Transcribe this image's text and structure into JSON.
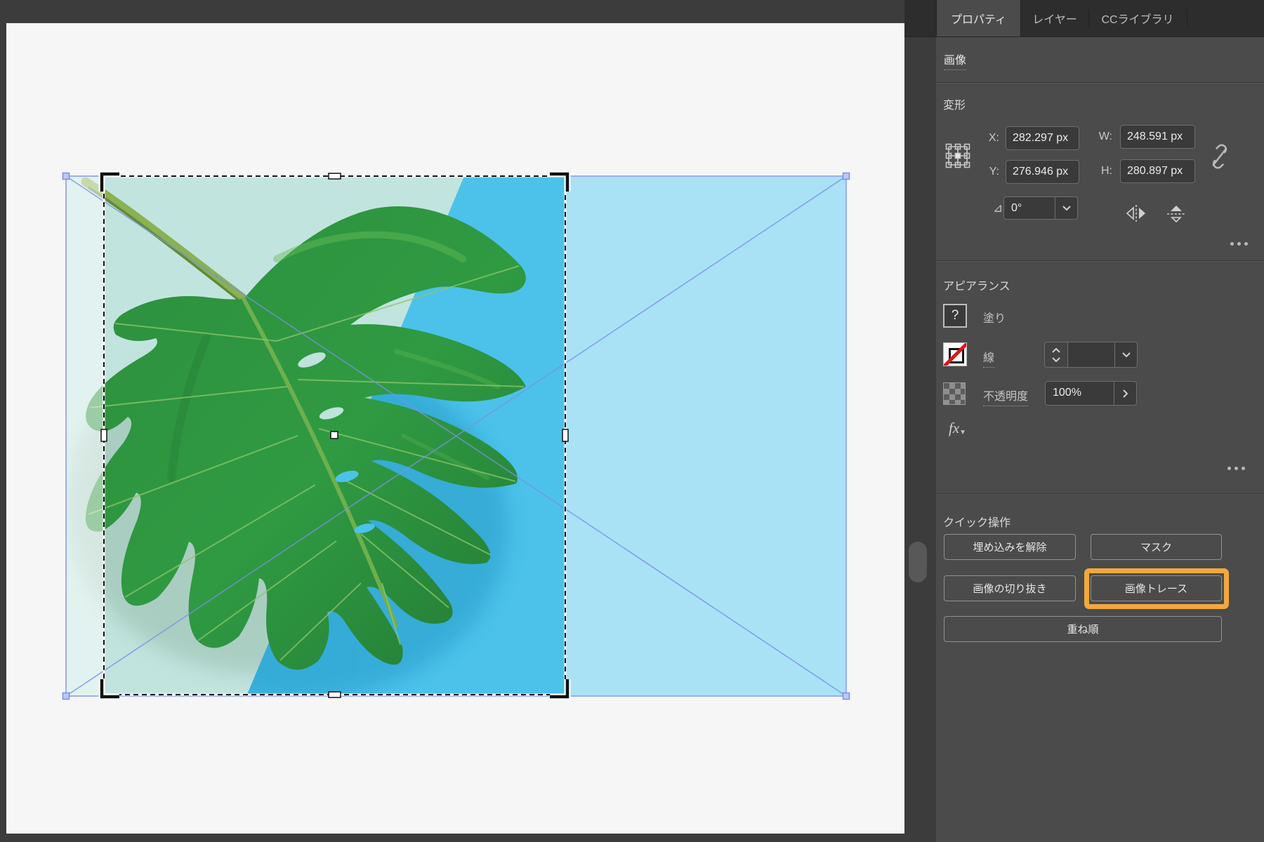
{
  "panel": {
    "tabs": [
      {
        "label": "プロパティ",
        "active": true
      },
      {
        "label": "レイヤー",
        "active": false
      },
      {
        "label": "CCライブラリ",
        "active": false
      }
    ],
    "object_type": "画像"
  },
  "transform": {
    "header": "変形",
    "fields": [
      {
        "label": "X:",
        "value": "282.297 px"
      },
      {
        "label": "Y:",
        "value": "276.946 px"
      },
      {
        "label": "W:",
        "value": "248.591 px"
      },
      {
        "label": "H:",
        "value": "280.897 px"
      }
    ],
    "angle_label": "⊿:",
    "angle_value": "0°"
  },
  "appearance": {
    "header": "アピアランス",
    "fill_label": "塗り",
    "fill_swatch_glyph": "?",
    "stroke_label": "線",
    "stroke_weight_value": "",
    "opacity_label": "不透明度",
    "opacity_value": "100%",
    "fx_label": "fx"
  },
  "quick_actions": {
    "header": "クイック操作",
    "buttons": [
      {
        "label": "埋め込みを解除",
        "highlighted": false
      },
      {
        "label": "マスク",
        "highlighted": false
      },
      {
        "label": "画像の切り抜き",
        "highlighted": false
      },
      {
        "label": "画像トレース",
        "highlighted": true
      },
      {
        "label": "重ね順",
        "highlighted": false
      }
    ]
  },
  "icons": [
    "reference-point-grid-icon",
    "unlink-icon",
    "angle-icon",
    "flip-horizontal-icon",
    "flip-vertical-icon",
    "more-options-icon",
    "fx-icon",
    "chevron-up-icon",
    "chevron-down-icon",
    "chevron-right-icon",
    "scrollbar-thumb",
    "selection-corner-handle",
    "crop-corner-bracket"
  ],
  "colors": {
    "highlight_orange": "#F2A83E",
    "selection_blue": "#7b90e8",
    "panel_bg": "#4b4b4b",
    "canvas_bg": "#f6f6f7",
    "photo_mint": "#c2e4df",
    "photo_blue": "#4cc2ea",
    "leaf_green": "#2e9140"
  }
}
